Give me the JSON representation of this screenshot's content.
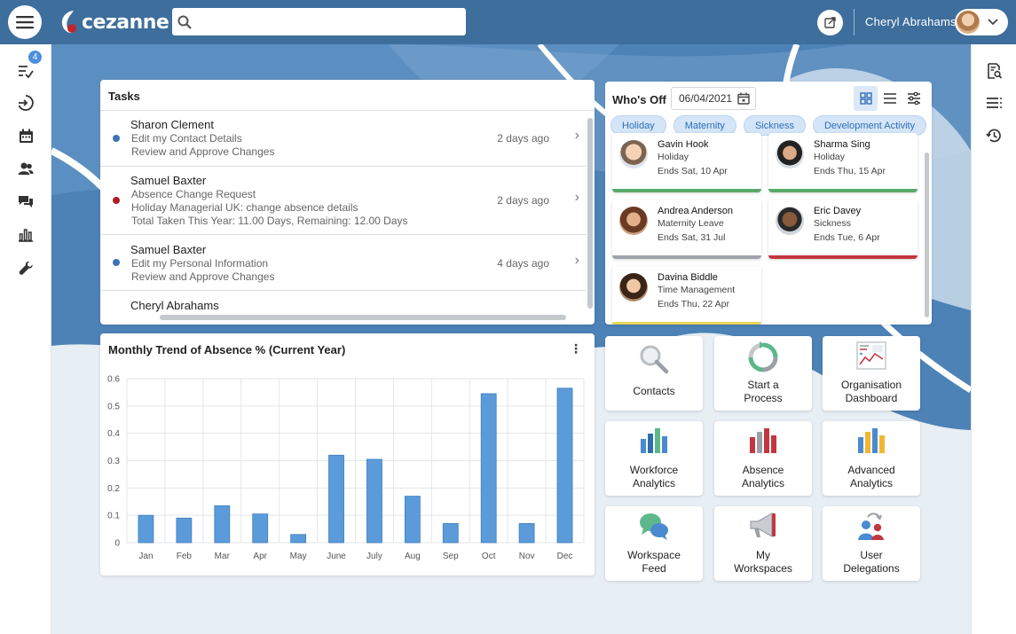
{
  "header": {
    "logo_text": "cezanne",
    "search_placeholder": "",
    "user_name": "Cheryl Abrahams"
  },
  "left_rail": {
    "tasks_badge": "4",
    "items": [
      "tasks-icon",
      "login-icon",
      "calendar-icon",
      "people-icon",
      "chat-icon",
      "chart-icon",
      "wrench-icon"
    ]
  },
  "right_rail": {
    "items": [
      "document-search-icon",
      "list-icon",
      "history-icon"
    ]
  },
  "tasks": {
    "title": "Tasks",
    "items": [
      {
        "name": "Sharon Clement",
        "lines": [
          "Edit my Contact Details",
          "Review and Approve Changes"
        ],
        "when": "2 days ago",
        "dot": "#3b73b4"
      },
      {
        "name": "Samuel Baxter",
        "lines": [
          "Absence Change Request",
          "Holiday Managerial UK: change absence details",
          "Total Taken This Year: 11.00 Days, Remaining: 12.00 Days"
        ],
        "when": "2 days ago",
        "dot": "#b01c25"
      },
      {
        "name": "Samuel Baxter",
        "lines": [
          "Edit my Personal Information",
          "Review and Approve Changes"
        ],
        "when": "4 days ago",
        "dot": "#3b73b4"
      },
      {
        "name": "Cheryl Abrahams",
        "lines": [],
        "when": "",
        "dot": ""
      }
    ]
  },
  "chart": {
    "title": "Monthly Trend of Absence % (Current Year)",
    "menu_icon": "kebab-icon"
  },
  "chart_data": {
    "type": "bar",
    "title": "Monthly Trend of Absence % (Current Year)",
    "categories": [
      "Jan",
      "Feb",
      "Mar",
      "Apr",
      "May",
      "June",
      "July",
      "Aug",
      "Sep",
      "Oct",
      "Nov",
      "Dec"
    ],
    "values": [
      0.1,
      0.09,
      0.135,
      0.105,
      0.03,
      0.32,
      0.305,
      0.17,
      0.07,
      0.545,
      0.07,
      0.565
    ],
    "ylim": [
      0,
      0.6
    ],
    "yticks": [
      "0",
      "0.1",
      "0.2",
      "0.3",
      "0.4",
      "0.5",
      "0.6"
    ],
    "grid": true,
    "colors": {
      "bar": "#5b9bd9",
      "bar_edge": "#3f7fc0"
    }
  },
  "whos_off": {
    "title": "Who's Off",
    "date": "06/04/2021",
    "filters": [
      "Holiday",
      "Maternity",
      "Sickness",
      "Development Activity"
    ],
    "people": [
      {
        "name": "Gavin Hook",
        "type": "Holiday",
        "ends": "Ends Sat, 10 Apr",
        "color": "#5aa86a"
      },
      {
        "name": "Sharma Sing",
        "type": "Holiday",
        "ends": "Ends Thu, 15 Apr",
        "color": "#5aa86a"
      },
      {
        "name": "Andrea Anderson",
        "type": "Maternity Leave",
        "ends": "Ends Sat, 31 Jul",
        "color": "#9ea3a8"
      },
      {
        "name": "Eric Davey",
        "type": "Sickness",
        "ends": "Ends Tue, 6 Apr",
        "color": "#c2373f"
      },
      {
        "name": "Davina Biddle",
        "type": "Time Management",
        "ends": "Ends Thu, 22 Apr",
        "color": "#e8d55a"
      }
    ]
  },
  "tiles": [
    {
      "label": [
        "Contacts"
      ],
      "icon": "magnifier-icon"
    },
    {
      "label": [
        "Start a",
        "Process"
      ],
      "icon": "process-cycle-icon"
    },
    {
      "label": [
        "Organisation",
        "Dashboard"
      ],
      "icon": "dashboard-icon"
    },
    {
      "label": [
        "Workforce",
        "Analytics"
      ],
      "icon": "bar-chart-blue-icon"
    },
    {
      "label": [
        "Absence",
        "Analytics"
      ],
      "icon": "bar-chart-red-icon"
    },
    {
      "label": [
        "Advanced",
        "Analytics"
      ],
      "icon": "bar-chart-yellow-icon"
    },
    {
      "label": [
        "Workspace",
        "Feed"
      ],
      "icon": "chat-bubbles-icon"
    },
    {
      "label": [
        "My",
        "Workspaces"
      ],
      "icon": "megaphone-icon"
    },
    {
      "label": [
        "User",
        "Delegations"
      ],
      "icon": "user-delegation-icon"
    }
  ]
}
